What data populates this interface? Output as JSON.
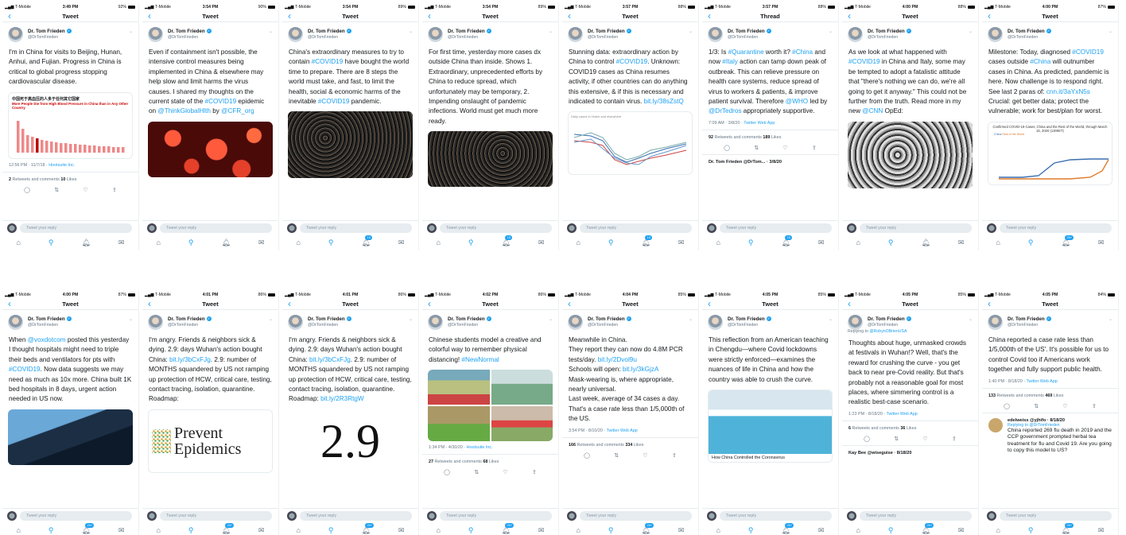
{
  "shared": {
    "carrier": "T-Mobile",
    "author": "Dr. Tom Frieden",
    "handle": "@DrTomFrieden",
    "reply_placeholder": "Tweet your reply",
    "icons": [
      "home-icon",
      "search-icon",
      "bell-icon",
      "mail-icon"
    ],
    "accent": "#1da1f2"
  },
  "screens": [
    {
      "time": "3:49 PM",
      "battery": "92%",
      "title": "Tweet",
      "text": "I'm in China for visits to Beijing, Hunan, Anhui, and Fujian. Progress in China is critical to global progress stopping cardiovascular disease.",
      "meta": "12:56 PM · 11/7/18 · Hootsuite Inc.",
      "stats": "2 Retweets and comments 10 Likes",
      "badge": "",
      "chart_title": "中国死于高血压的人多于任何其它国家",
      "chart_sub": "More People Die from High Blood Pressure in China than in Any Other Country"
    },
    {
      "time": "3:54 PM",
      "battery": "90%",
      "title": "Tweet",
      "text": "Even if containment isn't possible, the intensive control measures being implemented in China & elsewhere may help slow and limit harms the virus causes. I shared my thoughts on the current state of the #COVID19 epidemic on @ThinkGlobalHlth by @CFR_org",
      "badge": ""
    },
    {
      "time": "3:54 PM",
      "battery": "89%",
      "title": "Tweet",
      "text": "China's extraordinary measures to try to contain #COVID19 have bought the world time to prepare. There are 8 steps the world must take, and fast, to limit the health, social & economic harms of the inevitable #COVID19 pandemic.",
      "badge": "15"
    },
    {
      "time": "3:54 PM",
      "battery": "89%",
      "title": "Tweet",
      "text": "For first time, yesterday more cases dx outside China than inside. Shows 1. Extraordinary, unprecedented efforts by China to reduce spread, which unfortunately may be temporary, 2. Impending onslaught of pandemic infections. World must get much more ready.",
      "badge": "15"
    },
    {
      "time": "3:57 PM",
      "battery": "88%",
      "title": "Tweet",
      "text": "Stunning data: extraordinary action by China to control #COVID19. Unknown: COVID19 cases as China resumes activity, if other countries can do anything this extensive, & if this is necessary and indicated to contain virus. bit.ly/38sZstQ",
      "badge": "15",
      "chart_caption": "Daily cases in Hubei and elsewhere"
    },
    {
      "time": "3:57 PM",
      "battery": "88%",
      "title": "Thread",
      "text": "1/3: Is #Quarantine worth it? #China and now #Italy action can tamp down peak of outbreak. This can relieve pressure on health care systems, reduce spread of virus to workers & patients, & improve patient survival. Therefore @WHO led by @DrTedros appropriately supportive.",
      "meta": "7:09 AM · 3/8/20 · Twitter Web App",
      "stats": "92 Retweets and comments 189 Likes",
      "next": "Dr. Tom Frieden @DrTom... · 3/8/20",
      "badge": "15"
    },
    {
      "time": "4:00 PM",
      "battery": "88%",
      "title": "Tweet",
      "text": "As we look at what happened with #COVID19 in China and Italy, some may be tempted to adopt a fatalistic attitude that \"there's nothing we can do, we're all going to get it anyway.\" This could not be further from the truth. Read more in my new @CNN OpEd:",
      "badge": ""
    },
    {
      "time": "4:00 PM",
      "battery": "87%",
      "title": "Tweet",
      "text": "Milestone: Today, diagnosed #COVID19 cases outside #China will outnumber cases in China. As predicted, pandemic is here. Now challenge is to respond right. See last 2 paras of: cnn.it/3aYxN5s Crucial: get better data; protect the vulnerable; work for best/plan for worst.",
      "badge": "20+",
      "chart_title": "Confirmed COVID-19 Cases, China and the Rest of the World, through March 15, 2020 (1300ET)",
      "legend": [
        "China",
        "Rest of the World"
      ]
    },
    {
      "time": "4:00 PM",
      "battery": "87%",
      "title": "Tweet",
      "text": "When @voxdotcom posted this yesterday I thought hospitals might need to triple their beds and ventilators for pts with #COVID19. Now data suggests we may need as much as 10x more. China built 1K bed hospitals in 8 days, urgent action needed in US now.",
      "badge": "20+"
    },
    {
      "time": "4:01 PM",
      "battery": "86%",
      "title": "Tweet",
      "text": "I'm angry. Friends & neighbors sick & dying. 2.9: days Wuhan's action bought China: bit.ly/3bCxFJg. 2.9: number of MONTHS squandered by US not ramping up protection of HCW, critical care, testing, contact tracing, isolation, quarantine. Roadmap:",
      "badge": "20+",
      "card_text": "Prevent Epidemics"
    },
    {
      "time": "4:01 PM",
      "battery": "86%",
      "title": "Tweet",
      "text": "I'm angry. Friends & neighbors sick & dying. 2.9: days Wuhan's action bought China: bit.ly/3bCxFJg. 2.9: number of MONTHS squandered by US not ramping up protection of HCW, critical care, testing, contact tracing, isolation, quarantine. Roadmap: bit.ly/2R3RtgW",
      "badge": "20+",
      "card_text": "2.9"
    },
    {
      "time": "4:02 PM",
      "battery": "86%",
      "title": "Tweet",
      "text": "Chinese students model a creative and colorful way to remember physical distancing! #NewNormal",
      "meta": "1:34 PM · 4/30/20 · Hootsuite Inc.",
      "stats": "27 Retweets and comments 68 Likes",
      "badge": "20+"
    },
    {
      "time": "4:04 PM",
      "battery": "85%",
      "title": "Tweet",
      "text": "Meanwhile in China.\nThey report they can now do 4.8M PCR tests/day. bit.ly/2Dvol9u\nSchools will open: bit.ly/3kGjzA\nMask-wearing is, where appropriate, nearly universal.\nLast week, average of 34 cases a day. That's a case rate less than 1/5,000th of the US.",
      "meta": "3:54 PM · 8/10/20 · Twitter Web App",
      "stats": "166 Retweets and comments 334 Likes",
      "badge": "20+"
    },
    {
      "time": "4:05 PM",
      "battery": "85%",
      "title": "Tweet",
      "text": "This reflection from an American teaching in Chengdu—where Covid lockdowns were strictly enforced—examines the nuances of life in China and how the country was able to crush the curve.",
      "card_title": "How China Controlled the Coronavirus",
      "badge": "20+"
    },
    {
      "time": "4:05 PM",
      "battery": "85%",
      "title": "Tweet",
      "reply_to": "@RobynOBrienUSA",
      "text": "Thoughts about huge, unmasked crowds at festivals in Wuhan!? Well, that's the reward for crushing the curve - you get back to near pre-Covid reality. But that's probably not a reasonable goal for most places, where simmering control is a realistic best-case scenario.",
      "meta": "1:23 PM · 8/18/20 · Twitter Web App",
      "stats": "6 Retweets and comments 36 Likes",
      "next": "Kay Bee @wiseguise · 8/18/20",
      "badge": "20+"
    },
    {
      "time": "4:05 PM",
      "battery": "84%",
      "title": "Tweet",
      "text": "China reported a case rate less than 1/5,000th of the US'. It's possible for us to control Covid too if Americans work together and fully support public health.",
      "meta": "1:40 PM · 8/18/20 · Twitter Web App",
      "stats": "133 Retweets and comments 469 Likes",
      "reply_name": "edelweiss @yjhifo · 8/18/20",
      "reply_line": "Replying to @DrTomFrieden",
      "reply_text": "China reported 269 flu death in 2019 and the CCP government prompted herbal tea treatment for flu and Covid 19. Are you going to copy this model to US?",
      "badge": "20+"
    }
  ]
}
